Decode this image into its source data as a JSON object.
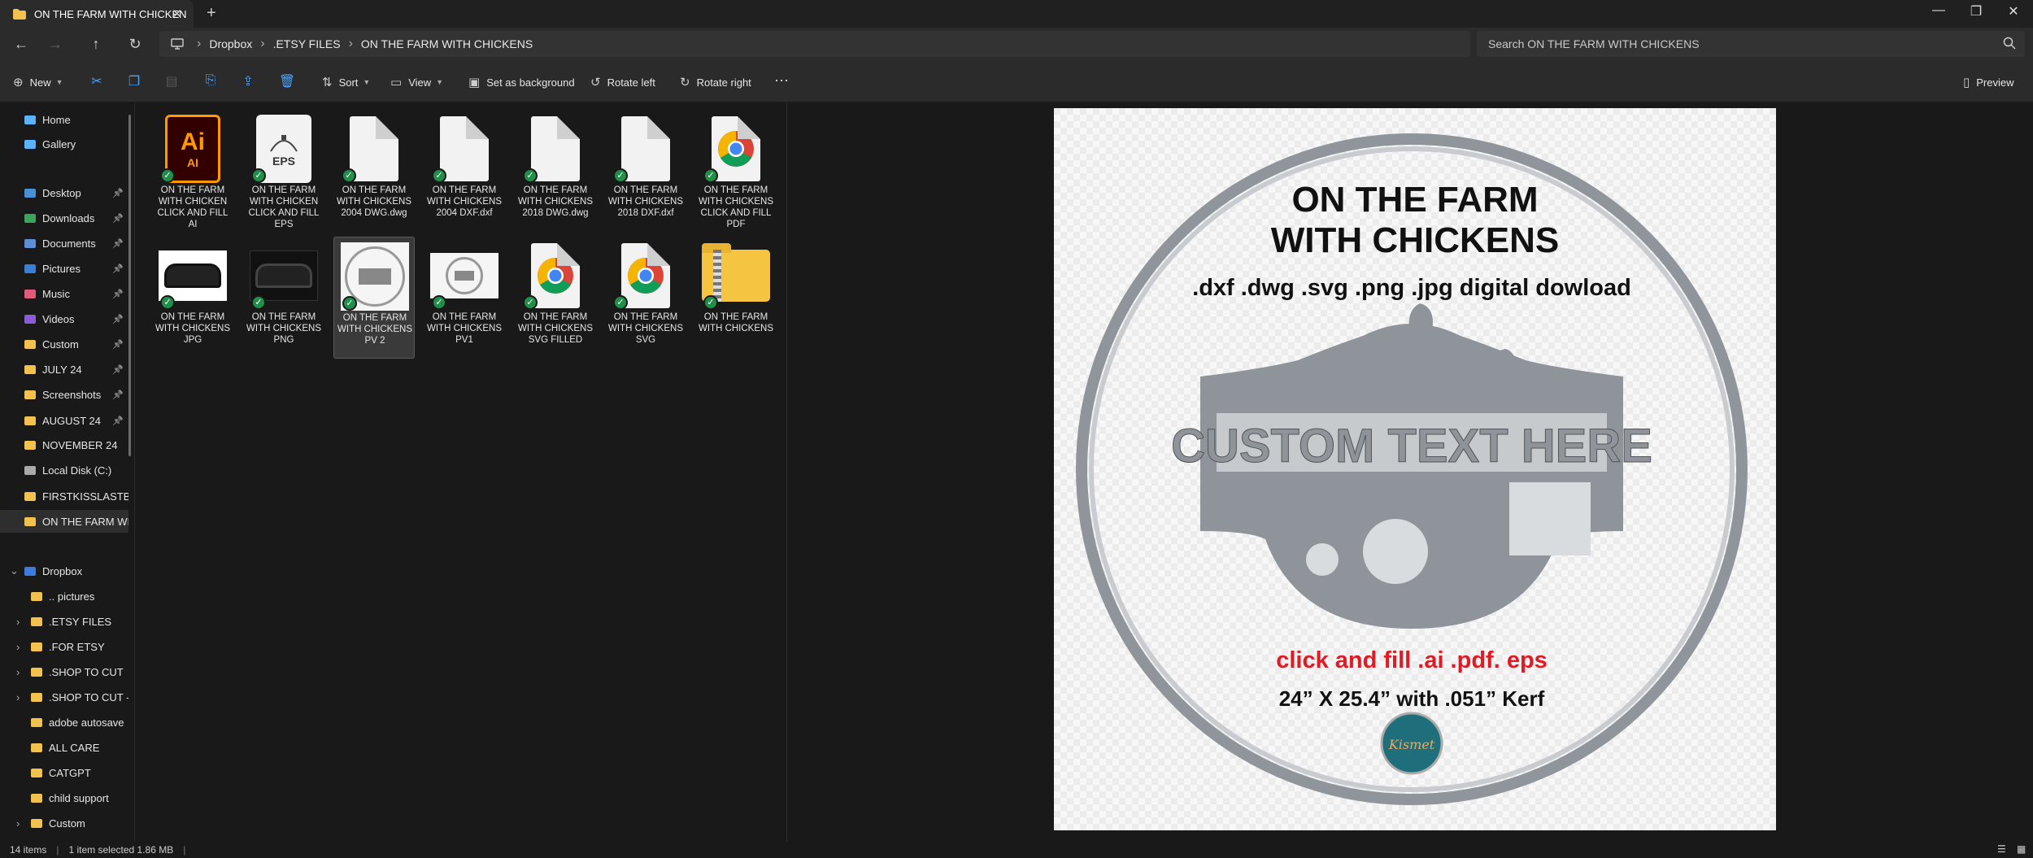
{
  "window": {
    "tab_title": "ON THE FARM WITH CHICKEN",
    "tab_close": "✕",
    "new_tab": "+",
    "controls": {
      "minimize": "—",
      "maximize": "❐",
      "close": "✕"
    }
  },
  "nav": {
    "back": "←",
    "forward": "→",
    "up": "↑",
    "refresh": "↻",
    "breadcrumb": [
      "Dropbox",
      ".ETSY FILES",
      "ON THE FARM WITH CHICKENS"
    ],
    "search_placeholder": "Search ON THE FARM WITH CHICKENS"
  },
  "toolbar": {
    "new_label": "New",
    "sort_label": "Sort",
    "view_label": "View",
    "set_background_label": "Set as background",
    "rotate_left_label": "Rotate left",
    "rotate_right_label": "Rotate right",
    "more_label": "···",
    "preview_label": "Preview"
  },
  "sidebar": {
    "items": [
      {
        "label": "Home"
      },
      {
        "label": "Gallery"
      },
      {
        "label": "Desktop"
      },
      {
        "label": "Downloads"
      },
      {
        "label": "Documents"
      },
      {
        "label": "Pictures"
      },
      {
        "label": "Music"
      },
      {
        "label": "Videos"
      },
      {
        "label": "Custom"
      },
      {
        "label": "JULY 24"
      },
      {
        "label": "Screenshots"
      },
      {
        "label": "AUGUST 24"
      },
      {
        "label": "NOVEMBER 24"
      },
      {
        "label": "Local Disk (C:)"
      },
      {
        "label": "FIRSTKISSLASTBREA"
      },
      {
        "label": "ON THE FARM WIT"
      },
      {
        "label": "Dropbox"
      },
      {
        "label": ".. pictures"
      },
      {
        "label": ".ETSY FILES"
      },
      {
        "label": ".FOR ETSY"
      },
      {
        "label": ".SHOP TO CUT"
      },
      {
        "label": ".SHOP TO CUT - ("
      },
      {
        "label": "adobe autosave"
      },
      {
        "label": "ALL CARE"
      },
      {
        "label": "CATGPT"
      },
      {
        "label": "child support"
      },
      {
        "label": "Custom"
      }
    ]
  },
  "files": [
    {
      "l1": "ON THE FARM",
      "l2": "WITH CHICKEN",
      "l3": "CLICK AND FILL",
      "l4": "AI",
      "icon": "ai-file-icon"
    },
    {
      "l1": "ON THE FARM",
      "l2": "WITH CHICKEN",
      "l3": "CLICK AND FILL",
      "l4": "EPS",
      "icon": "eps-file-icon"
    },
    {
      "l1": "ON THE FARM",
      "l2": "WITH CHICKENS",
      "l3": "2004 DWG.dwg",
      "l4": "",
      "icon": "document-icon"
    },
    {
      "l1": "ON THE FARM",
      "l2": "WITH CHICKENS",
      "l3": "2004 DXF.dxf",
      "l4": "",
      "icon": "document-icon"
    },
    {
      "l1": "ON THE FARM",
      "l2": "WITH CHICKENS",
      "l3": "2018 DWG.dwg",
      "l4": "",
      "icon": "document-icon"
    },
    {
      "l1": "ON THE FARM",
      "l2": "WITH CHICKENS",
      "l3": "2018 DXF.dxf",
      "l4": "",
      "icon": "document-icon"
    },
    {
      "l1": "ON THE FARM",
      "l2": "WITH CHICKENS",
      "l3": "CLICK AND FILL",
      "l4": "PDF",
      "icon": "chrome-icon"
    },
    {
      "l1": "ON THE FARM",
      "l2": "WITH CHICKENS",
      "l3": "JPG",
      "l4": "",
      "icon": "image-thumbnail"
    },
    {
      "l1": "ON THE FARM",
      "l2": "WITH CHICKENS",
      "l3": "PNG",
      "l4": "",
      "icon": "image-thumbnail"
    },
    {
      "l1": "ON THE FARM",
      "l2": "WITH CHICKENS",
      "l3": "PV 2",
      "l4": "",
      "icon": "image-thumbnail"
    },
    {
      "l1": "ON THE FARM",
      "l2": "WITH CHICKENS",
      "l3": "PV1",
      "l4": "",
      "icon": "image-thumbnail"
    },
    {
      "l1": "ON THE FARM",
      "l2": "WITH CHICKENS",
      "l3": "SVG FILLED",
      "l4": "",
      "icon": "chrome-icon"
    },
    {
      "l1": "ON THE FARM",
      "l2": "WITH CHICKENS",
      "l3": "SVG",
      "l4": "",
      "icon": "chrome-icon"
    },
    {
      "l1": "ON THE FARM",
      "l2": "WITH CHICKENS",
      "l3": "",
      "l4": "",
      "icon": "zip-folder-icon"
    }
  ],
  "preview": {
    "title1": "ON THE FARM",
    "title2": "WITH CHICKENS",
    "formats": ".dxf .dwg .svg .png .jpg digital dowload",
    "custom_text": "CUSTOM TEXT HERE",
    "click_fill": "click and fill .ai .pdf. eps",
    "size": "24” X 25.4” with .051” Kerf",
    "logo": "Kismet"
  },
  "status": {
    "count": "14 items",
    "selected": "1 item selected  1.86 MB"
  }
}
